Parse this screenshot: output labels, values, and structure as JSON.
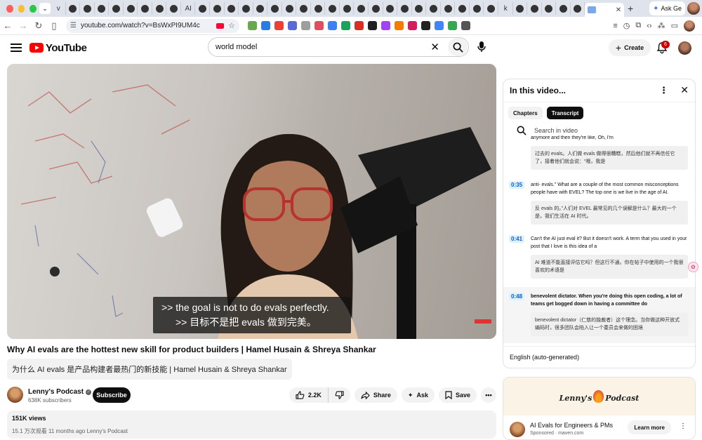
{
  "browser": {
    "address_url": "youtube.com/watch?v=BsWxPI9UM4c",
    "ask_tab_label": "Ask Ge",
    "pinned_tab_glyphs": [
      "v",
      "",
      "",
      "",
      "",
      "",
      "",
      "",
      "",
      "AI",
      "",
      "",
      "",
      "",
      "",
      "",
      "",
      "",
      "",
      "",
      "",
      "",
      "",
      "",
      "",
      "",
      "",
      "",
      "",
      "",
      "",
      "k",
      "",
      "",
      "",
      "",
      ""
    ],
    "ext_colors": [
      "#6aa84f",
      "#2a7be4",
      "#e94235",
      "#5b6bd6",
      "#9e9e9e",
      "#e04f5f",
      "#3b82f6",
      "#1aa260",
      "#d93025",
      "#222222",
      "#a142f4",
      "#f57c00",
      "#d81b60",
      "#222222",
      "#4285f4",
      "#34a853",
      "#555555"
    ]
  },
  "youtube": {
    "logo_text": "YouTube",
    "search_query": "world model",
    "create_label": "Create",
    "notification_count": "6"
  },
  "video": {
    "caption_line_1": ">> the goal is not to do evals perfectly.",
    "caption_line_2": ">> 目标不是把 evals 做到完美。",
    "title": "Why AI evals are the hottest new skill for product builders | Hamel Husain & Shreya Shankar",
    "translated_title": "为什么 AI evals 是产品构建者最热门的新技能 | Hamel Husain & Shreya Shankar"
  },
  "channel": {
    "name": "Lenny's Podcast",
    "subscribers": "638K subscribers",
    "subscribe_label": "Subscribe",
    "like_count": "2.2K",
    "share_label": "Share",
    "ask_label": "Ask",
    "save_label": "Save"
  },
  "description": {
    "views": "151K views",
    "meta": "15.1 万次观看   11 months ago   Lenny's Podcast"
  },
  "panel": {
    "title": "In this video...",
    "tab_chapters": "Chapters",
    "tab_transcript": "Transcript",
    "search_placeholder": "Search in video",
    "segments": [
      {
        "time": "",
        "en": "anymore and then they're like, Oh, I'm",
        "zh": "过去的 evals。人们做 evals 做得很糟糕，然后他们就不再信任它了，接着他们就会说：“哦，我是"
      },
      {
        "time": "0:35",
        "en": "anti- evals.\" What are a couple of the most common misconceptions people have with EVEL? The top one is we live in the age of AI.",
        "zh": "反 evals 的。”人们对 EVEL 最常见的几个误解是什么？最大的一个是，我们生活在 AI 时代。"
      },
      {
        "time": "0:41",
        "en": "Can't the AI just eval it? But it doesn't work. A term that you used in your post that I love is this idea of a",
        "zh": "AI 难道不能直接评估它吗？但这行不通。你在帖子中使用的一个我很喜欢的术语是"
      },
      {
        "time": "0:48",
        "en": "benevolent dictator. When you're doing this open coding, a lot of teams get bogged down in having a committee do",
        "zh": "benevolent dictator（仁慈的独裁者）这个理念。当你做这种开放式编码时，很多团队会陷入让一个委员会来做的困境"
      }
    ],
    "language": "English (auto-generated)"
  },
  "ad": {
    "logo_left": "Lenny's",
    "logo_right": "Podcast",
    "title": "AI Evals for Engineers & PMs",
    "sponsor": "Sponsored · maven.com",
    "cta": "Learn more"
  }
}
